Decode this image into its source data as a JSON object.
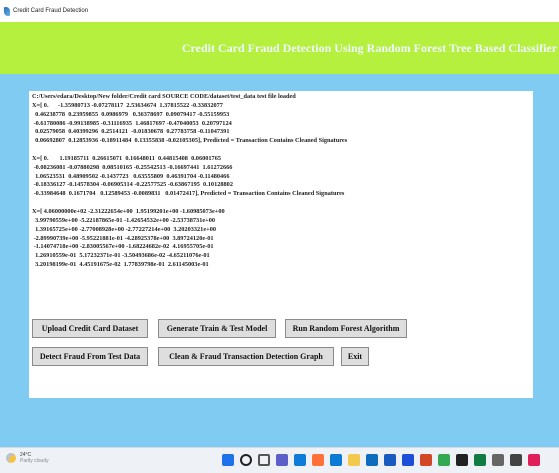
{
  "window": {
    "title": "Credit Card Fraud Detection"
  },
  "banner": {
    "title": "Credit Card Fraud Detection Using Random Forest Tree Based Classifier"
  },
  "output": {
    "lines": [
      "C:/Users/edara/Desktop/New folder/Credit card SOURCE CODE/dataset/test_data test file loaded",
      "X=[ 0.      -1.35980713 -0.07278117  2.53634674  1.37815522 -0.33832077",
      "  0.46238778  0.23959855  0.0986979   0.36378697  0.09079417 -0.55159953",
      " -0.61780086 -0.99138985 -0.31116935  1.46817697 -0.47040053  0.20797124",
      "  0.02579058  0.40399296  0.2514121  -0.01830678  0.27783758 -0.11047391",
      "  0.06692807  0.12853936 -0.18911484  0.13355838 -0.02105305], Predicted = Transaction Contains Cleaned Signatures",
      "",
      "X=[ 0.       1.19185711  0.26615071  0.16648011  0.44815408  0.06001765",
      " -0.08236081 -0.07880298  0.08510165 -0.25542513 -0.16697441  1.61272666",
      "  1.06523531  0.48909502 -0.1437723   0.63555809  0.46391704 -0.11480466",
      " -0.18336127 -0.14578304 -0.06905314 -0.22577525 -0.63867195  0.10128802",
      " -0.33984648  0.1671704   0.12589453 -0.0089831   0.01472417], Predicted = Transaction Contains Cleaned Signatures",
      "",
      "X=[ 4.06000000e+02 -2.31222654e+00  1.95199201e+00 -1.60985073e+00",
      "  3.99790559e+00 -5.22187865e-01 -1.42654532e+00 -2.53738731e+00",
      "  1.39165725e+00 -2.77008928e+00 -2.77227214e+00  3.20203321e+00",
      " -2.89990739e+00 -5.95221881e-01 -4.28925378e+00  3.89724120e-01",
      " -1.14074718e+00 -2.83005567e+00 -1.68224682e-02  4.16955705e-01",
      "  1.26910559e-01  5.17232371e-01 -3.50493686e-02 -4.65211076e-01",
      "  3.20198199e-01  4.45191675e-02  1.77839798e-01  2.61145003e-01"
    ]
  },
  "buttons": {
    "upload": "Upload Credit Card Dataset",
    "generate": "Generate Train & Test Model",
    "run_rf": "Run Random Forest Algorithm",
    "detect": "Detect Fraud From Test Data",
    "graph": "Clean & Fraud Transaction Detection Graph",
    "exit": "Exit"
  },
  "taskbar": {
    "weather_temp": "24°C",
    "weather_desc": "Partly cloudy",
    "icons": [
      "windows-start-icon",
      "search-icon",
      "task-view-icon",
      "teams-icon",
      "edge-icon",
      "firefox-icon",
      "vscode-icon",
      "file-explorer-icon",
      "mail-icon",
      "word-icon",
      "photos-icon",
      "powerpoint-icon",
      "chrome-icon",
      "dell-icon",
      "excel-icon",
      "settings-icon",
      "store-icon",
      "slack-icon"
    ]
  },
  "colors": {
    "background": "#7fcbf1",
    "banner": "#b5f03e",
    "banner_text": "#f0f8ff",
    "button_bg": "#dedede"
  }
}
